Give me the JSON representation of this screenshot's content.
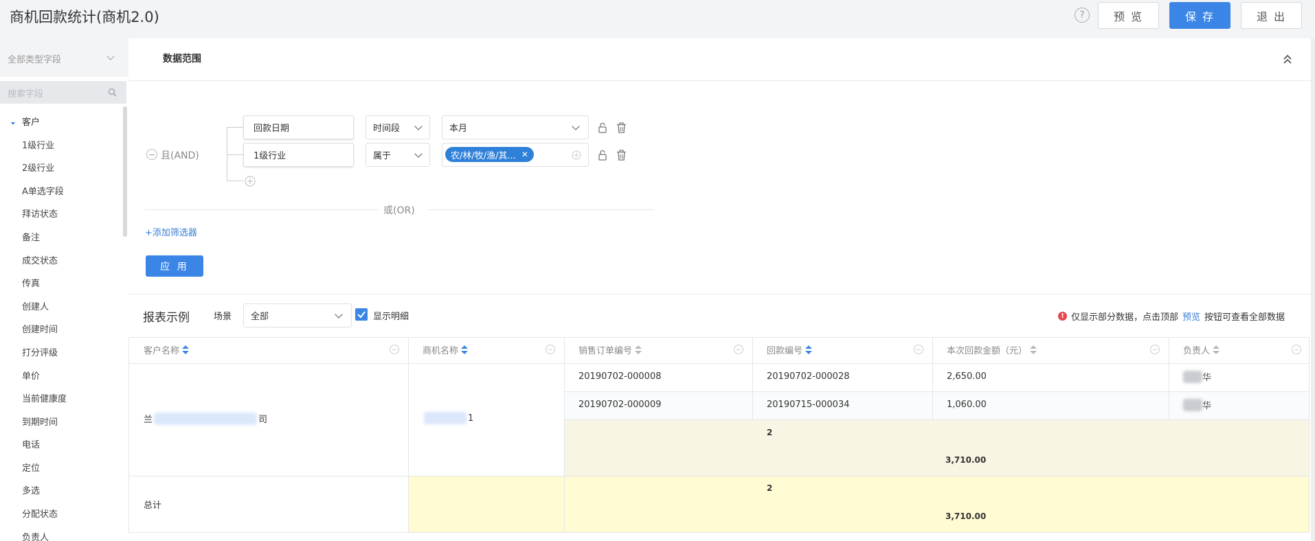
{
  "header": {
    "title": "商机回款统计(商机2.0)",
    "help_icon": "?",
    "preview_label": "预 览",
    "save_label": "保 存",
    "exit_label": "退 出"
  },
  "sidebar": {
    "type_select_value": "全部类型字段",
    "search_placeholder": "搜索字段",
    "group_label": "客户",
    "items": [
      "1级行业",
      "2级行业",
      "A单选字段",
      "拜访状态",
      "备注",
      "成交状态",
      "传真",
      "创建人",
      "创建时间",
      "打分评级",
      "单价",
      "当前健康度",
      "到期时间",
      "电话",
      "定位",
      "多选",
      "分配状态",
      "负责人"
    ]
  },
  "filter": {
    "section_title": "数据范围",
    "and_label": "且(AND)",
    "or_label": "或(OR)",
    "add_filter_label": "+添加筛选器",
    "apply_label": "应 用",
    "rows": [
      {
        "field": "回款日期",
        "operator": "时间段",
        "value": "本月"
      },
      {
        "field": "1级行业",
        "operator": "属于",
        "tag": "农/林/牧/渔/其..."
      }
    ]
  },
  "report": {
    "title": "报表示例",
    "scene_label": "场景",
    "scene_value": "全部",
    "show_detail_label": "显示明细",
    "notice_before": "仅显示部分数据，点击顶部",
    "notice_link": "预览",
    "notice_after": "按钮可查看全部数据",
    "columns": [
      "客户名称",
      "商机名称",
      "销售订单编号",
      "回款编号",
      "本次回款金额（元）",
      "负责人"
    ],
    "customer_first": "兰",
    "customer_last": "司",
    "opportunity_suffix": "1",
    "rows": [
      {
        "order_no": "20190702-000008",
        "payment_no": "20190702-000028",
        "amount": "2,650.00",
        "owner_suffix": "华"
      },
      {
        "order_no": "20190702-000009",
        "payment_no": "20190715-000034",
        "amount": "1,060.00",
        "owner_suffix": "华"
      }
    ],
    "subtotal": {
      "count": "2",
      "amount": "3,710.00"
    },
    "total": {
      "label": "总计",
      "count": "2",
      "amount": "3,710.00"
    }
  },
  "colors": {
    "accent": "#3a85e6",
    "link": "#3a7fd5",
    "subtotal_bg": "#f8f5e4",
    "total_bg": "#fffbd2",
    "notice_red": "#e5484d"
  }
}
